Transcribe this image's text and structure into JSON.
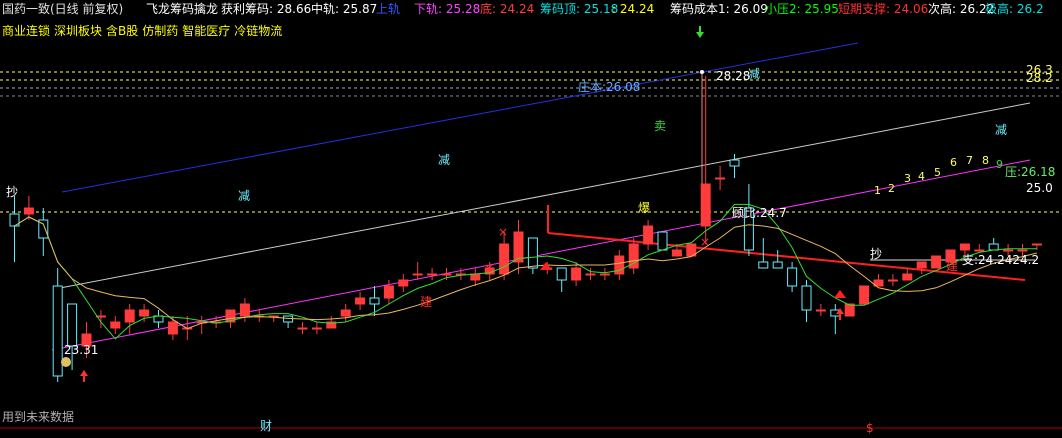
{
  "header": [
    {
      "text": "国药一致(日线 前复权)",
      "color": "#e0e0e0"
    },
    {
      "text": "飞龙筹码擒龙",
      "color": "#ffffff"
    },
    {
      "text": "获利筹码: 28.66",
      "color": "#ffffff"
    },
    {
      "text": "中轨: 25.87",
      "color": "#ffffff"
    },
    {
      "text": "上轨",
      "color": "#3355ff"
    },
    {
      "text": "下轨: 25.28",
      "color": "#ff44ff"
    },
    {
      "text": "底: 24.24",
      "color": "#ff3b3b"
    },
    {
      "text": "筹码顶: 25.18",
      "color": "#00e0e0"
    },
    {
      "text": ": 24.24",
      "color": "#ffff00"
    },
    {
      "text": "筹码成本1: 26.09",
      "color": "#ffffff"
    },
    {
      "text": "小压2: 25.95",
      "color": "#00ff00"
    },
    {
      "text": "短期支撑: 24.06",
      "color": "#ff3030"
    },
    {
      "text": "次高: 26.22",
      "color": "#ffffff"
    },
    {
      "text": "极高: 26.2",
      "color": "#00e0e0"
    }
  ],
  "tags": [
    "商业连锁",
    "深圳板块",
    "含B股",
    "仿制药",
    "智能医疗",
    "冷链物流"
  ],
  "footer_note": "用到未来数据",
  "labels": {
    "chao1": "抄",
    "jian1": "减",
    "jian2": "减",
    "jian3": "减",
    "jian4": "减",
    "mai": "卖",
    "bao": "爆",
    "jian_build1": "建",
    "jian_build2": "建",
    "chao2": "抄",
    "cai": "财",
    "dollar": "$",
    "zhuangben": "庄本:26.08",
    "high_price": "28.28",
    "low_price": "23.31",
    "guibi": "顾比:24.7",
    "support": "支:24.2424.2",
    "upper_right": "26.3",
    "upper_right2": "28.2",
    "bp": "压:26.18",
    "right_val": "25.0"
  },
  "counts": [
    "1",
    "2",
    "3",
    "4",
    "5",
    "6",
    "7",
    "8",
    "9"
  ],
  "colors": {
    "up": "#ff3b3b",
    "down": "#66eeff",
    "ma": "#ffffff",
    "ma2": "#33dd33",
    "upper": "#2233dd",
    "lower": "#ff33ff",
    "support": "#ff2020"
  },
  "chart_data": {
    "type": "candlestick",
    "candles": [
      [
        26.0,
        26.3,
        25.2,
        25.8
      ],
      [
        26.0,
        26.3,
        25.9,
        26.1
      ],
      [
        25.9,
        26.1,
        25.3,
        25.6
      ],
      [
        24.8,
        25.1,
        23.2,
        23.3
      ],
      [
        24.5,
        24.5,
        23.4,
        23.8
      ],
      [
        23.8,
        24.2,
        23.6,
        24.0
      ],
      [
        24.3,
        24.4,
        24.1,
        24.3
      ],
      [
        24.1,
        24.3,
        24.0,
        24.2
      ],
      [
        24.2,
        24.5,
        24.0,
        24.4
      ],
      [
        24.3,
        24.5,
        24.2,
        24.4
      ],
      [
        24.3,
        24.4,
        24.1,
        24.2
      ],
      [
        24.0,
        24.3,
        23.9,
        24.2
      ],
      [
        24.1,
        24.3,
        23.9,
        24.1
      ],
      [
        24.2,
        24.3,
        24.0,
        24.2
      ],
      [
        24.2,
        24.3,
        24.1,
        24.2
      ],
      [
        24.2,
        24.4,
        24.1,
        24.4
      ],
      [
        24.3,
        24.6,
        24.2,
        24.5
      ],
      [
        24.3,
        24.4,
        24.2,
        24.3
      ],
      [
        24.3,
        24.3,
        24.2,
        24.3
      ],
      [
        24.3,
        24.3,
        24.1,
        24.2
      ],
      [
        24.1,
        24.2,
        24.0,
        24.1
      ],
      [
        24.1,
        24.2,
        24.0,
        24.1
      ],
      [
        24.1,
        24.3,
        24.1,
        24.2
      ],
      [
        24.3,
        24.5,
        24.2,
        24.4
      ],
      [
        24.5,
        24.7,
        24.4,
        24.6
      ],
      [
        24.6,
        24.8,
        24.3,
        24.5
      ],
      [
        24.6,
        24.9,
        24.5,
        24.8
      ],
      [
        24.8,
        25.0,
        24.7,
        24.9
      ],
      [
        25.0,
        25.2,
        24.9,
        25.0
      ],
      [
        25.0,
        25.1,
        24.9,
        25.0
      ],
      [
        25.0,
        25.1,
        24.9,
        25.0
      ],
      [
        25.0,
        25.1,
        24.9,
        25.0
      ],
      [
        24.9,
        25.1,
        24.8,
        25.0
      ],
      [
        25.0,
        25.2,
        24.9,
        25.1
      ],
      [
        25.0,
        25.7,
        24.9,
        25.5
      ],
      [
        25.2,
        25.9,
        25.0,
        25.7
      ],
      [
        25.6,
        25.6,
        25.0,
        25.1
      ],
      [
        25.1,
        25.2,
        25.0,
        25.1
      ],
      [
        25.1,
        25.1,
        24.7,
        24.9
      ],
      [
        24.9,
        25.2,
        24.8,
        25.1
      ],
      [
        25.0,
        25.1,
        24.9,
        25.0
      ],
      [
        25.0,
        25.1,
        24.9,
        25.0
      ],
      [
        25.0,
        25.4,
        24.9,
        25.3
      ],
      [
        25.1,
        25.6,
        25.0,
        25.5
      ],
      [
        25.5,
        25.9,
        25.4,
        25.8
      ],
      [
        25.7,
        25.7,
        25.4,
        25.4
      ],
      [
        25.3,
        25.5,
        25.3,
        25.4
      ],
      [
        25.3,
        25.5,
        25.3,
        25.5
      ],
      [
        25.8,
        28.3,
        25.5,
        26.5
      ],
      [
        26.6,
        26.8,
        26.4,
        26.6
      ],
      [
        26.9,
        27.0,
        26.6,
        26.8
      ],
      [
        26.1,
        26.5,
        25.3,
        25.4
      ],
      [
        25.2,
        25.6,
        25.1,
        25.1
      ],
      [
        25.2,
        25.4,
        25.1,
        25.1
      ],
      [
        25.1,
        25.2,
        24.7,
        24.8
      ],
      [
        24.8,
        24.9,
        24.2,
        24.4
      ],
      [
        24.4,
        24.5,
        24.3,
        24.4
      ],
      [
        24.4,
        24.5,
        24.0,
        24.3
      ],
      [
        24.3,
        24.5,
        24.3,
        24.5
      ],
      [
        24.5,
        24.8,
        24.5,
        24.8
      ],
      [
        24.8,
        25.0,
        24.8,
        24.9
      ],
      [
        24.9,
        25.0,
        24.8,
        24.9
      ],
      [
        24.9,
        25.1,
        24.9,
        25.0
      ],
      [
        25.1,
        25.2,
        25.0,
        25.2
      ],
      [
        25.1,
        25.3,
        25.1,
        25.3
      ],
      [
        25.2,
        25.4,
        25.2,
        25.4
      ],
      [
        25.4,
        25.5,
        25.3,
        25.5
      ],
      [
        25.4,
        25.5,
        25.4,
        25.4
      ],
      [
        25.5,
        25.6,
        25.4,
        25.4
      ],
      [
        25.4,
        25.5,
        25.3,
        25.4
      ],
      [
        25.4,
        25.5,
        25.3,
        25.4
      ],
      [
        25.5,
        25.5,
        25.4,
        25.5
      ]
    ],
    "price_range": [
      22.9,
      28.9
    ]
  }
}
